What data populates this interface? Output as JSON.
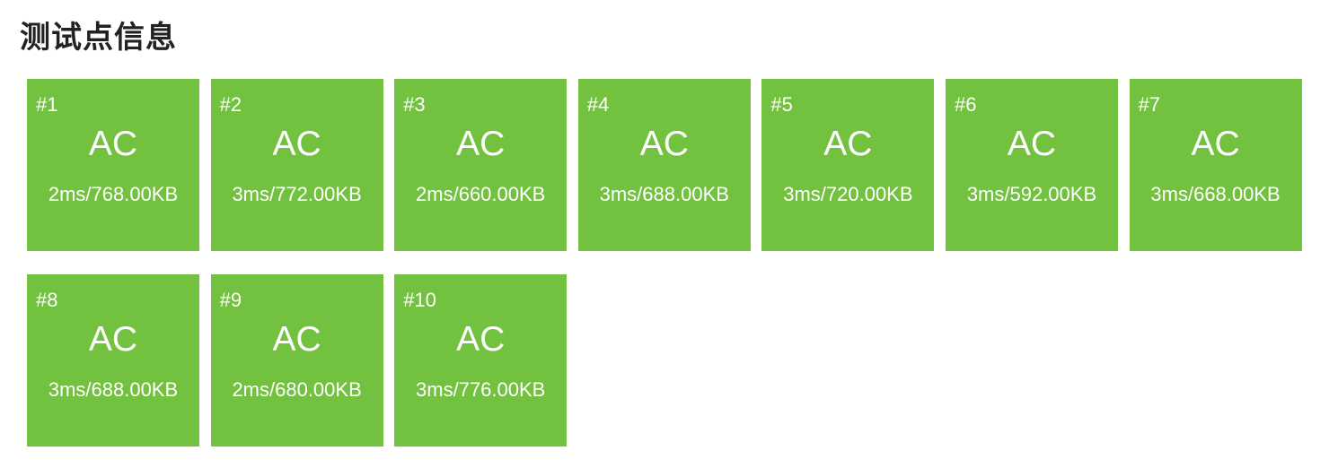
{
  "section": {
    "title": "测试点信息"
  },
  "colors": {
    "accepted": "#72c240",
    "text_on_tile": "#ffffff"
  },
  "test_cases": [
    {
      "id": "#1",
      "status": "AC",
      "stats": "2ms/768.00KB"
    },
    {
      "id": "#2",
      "status": "AC",
      "stats": "3ms/772.00KB"
    },
    {
      "id": "#3",
      "status": "AC",
      "stats": "2ms/660.00KB"
    },
    {
      "id": "#4",
      "status": "AC",
      "stats": "3ms/688.00KB"
    },
    {
      "id": "#5",
      "status": "AC",
      "stats": "3ms/720.00KB"
    },
    {
      "id": "#6",
      "status": "AC",
      "stats": "3ms/592.00KB"
    },
    {
      "id": "#7",
      "status": "AC",
      "stats": "3ms/668.00KB"
    },
    {
      "id": "#8",
      "status": "AC",
      "stats": "3ms/688.00KB"
    },
    {
      "id": "#9",
      "status": "AC",
      "stats": "2ms/680.00KB"
    },
    {
      "id": "#10",
      "status": "AC",
      "stats": "3ms/776.00KB"
    }
  ]
}
